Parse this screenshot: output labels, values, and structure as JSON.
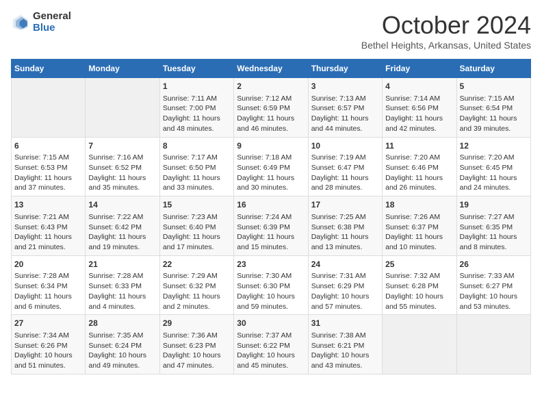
{
  "logo": {
    "general": "General",
    "blue": "Blue"
  },
  "title": "October 2024",
  "location": "Bethel Heights, Arkansas, United States",
  "days_of_week": [
    "Sunday",
    "Monday",
    "Tuesday",
    "Wednesday",
    "Thursday",
    "Friday",
    "Saturday"
  ],
  "weeks": [
    [
      {
        "day": null,
        "sunrise": null,
        "sunset": null,
        "daylight": null
      },
      {
        "day": null,
        "sunrise": null,
        "sunset": null,
        "daylight": null
      },
      {
        "day": "1",
        "sunrise": "Sunrise: 7:11 AM",
        "sunset": "Sunset: 7:00 PM",
        "daylight": "Daylight: 11 hours and 48 minutes."
      },
      {
        "day": "2",
        "sunrise": "Sunrise: 7:12 AM",
        "sunset": "Sunset: 6:59 PM",
        "daylight": "Daylight: 11 hours and 46 minutes."
      },
      {
        "day": "3",
        "sunrise": "Sunrise: 7:13 AM",
        "sunset": "Sunset: 6:57 PM",
        "daylight": "Daylight: 11 hours and 44 minutes."
      },
      {
        "day": "4",
        "sunrise": "Sunrise: 7:14 AM",
        "sunset": "Sunset: 6:56 PM",
        "daylight": "Daylight: 11 hours and 42 minutes."
      },
      {
        "day": "5",
        "sunrise": "Sunrise: 7:15 AM",
        "sunset": "Sunset: 6:54 PM",
        "daylight": "Daylight: 11 hours and 39 minutes."
      }
    ],
    [
      {
        "day": "6",
        "sunrise": "Sunrise: 7:15 AM",
        "sunset": "Sunset: 6:53 PM",
        "daylight": "Daylight: 11 hours and 37 minutes."
      },
      {
        "day": "7",
        "sunrise": "Sunrise: 7:16 AM",
        "sunset": "Sunset: 6:52 PM",
        "daylight": "Daylight: 11 hours and 35 minutes."
      },
      {
        "day": "8",
        "sunrise": "Sunrise: 7:17 AM",
        "sunset": "Sunset: 6:50 PM",
        "daylight": "Daylight: 11 hours and 33 minutes."
      },
      {
        "day": "9",
        "sunrise": "Sunrise: 7:18 AM",
        "sunset": "Sunset: 6:49 PM",
        "daylight": "Daylight: 11 hours and 30 minutes."
      },
      {
        "day": "10",
        "sunrise": "Sunrise: 7:19 AM",
        "sunset": "Sunset: 6:47 PM",
        "daylight": "Daylight: 11 hours and 28 minutes."
      },
      {
        "day": "11",
        "sunrise": "Sunrise: 7:20 AM",
        "sunset": "Sunset: 6:46 PM",
        "daylight": "Daylight: 11 hours and 26 minutes."
      },
      {
        "day": "12",
        "sunrise": "Sunrise: 7:20 AM",
        "sunset": "Sunset: 6:45 PM",
        "daylight": "Daylight: 11 hours and 24 minutes."
      }
    ],
    [
      {
        "day": "13",
        "sunrise": "Sunrise: 7:21 AM",
        "sunset": "Sunset: 6:43 PM",
        "daylight": "Daylight: 11 hours and 21 minutes."
      },
      {
        "day": "14",
        "sunrise": "Sunrise: 7:22 AM",
        "sunset": "Sunset: 6:42 PM",
        "daylight": "Daylight: 11 hours and 19 minutes."
      },
      {
        "day": "15",
        "sunrise": "Sunrise: 7:23 AM",
        "sunset": "Sunset: 6:40 PM",
        "daylight": "Daylight: 11 hours and 17 minutes."
      },
      {
        "day": "16",
        "sunrise": "Sunrise: 7:24 AM",
        "sunset": "Sunset: 6:39 PM",
        "daylight": "Daylight: 11 hours and 15 minutes."
      },
      {
        "day": "17",
        "sunrise": "Sunrise: 7:25 AM",
        "sunset": "Sunset: 6:38 PM",
        "daylight": "Daylight: 11 hours and 13 minutes."
      },
      {
        "day": "18",
        "sunrise": "Sunrise: 7:26 AM",
        "sunset": "Sunset: 6:37 PM",
        "daylight": "Daylight: 11 hours and 10 minutes."
      },
      {
        "day": "19",
        "sunrise": "Sunrise: 7:27 AM",
        "sunset": "Sunset: 6:35 PM",
        "daylight": "Daylight: 11 hours and 8 minutes."
      }
    ],
    [
      {
        "day": "20",
        "sunrise": "Sunrise: 7:28 AM",
        "sunset": "Sunset: 6:34 PM",
        "daylight": "Daylight: 11 hours and 6 minutes."
      },
      {
        "day": "21",
        "sunrise": "Sunrise: 7:28 AM",
        "sunset": "Sunset: 6:33 PM",
        "daylight": "Daylight: 11 hours and 4 minutes."
      },
      {
        "day": "22",
        "sunrise": "Sunrise: 7:29 AM",
        "sunset": "Sunset: 6:32 PM",
        "daylight": "Daylight: 11 hours and 2 minutes."
      },
      {
        "day": "23",
        "sunrise": "Sunrise: 7:30 AM",
        "sunset": "Sunset: 6:30 PM",
        "daylight": "Daylight: 10 hours and 59 minutes."
      },
      {
        "day": "24",
        "sunrise": "Sunrise: 7:31 AM",
        "sunset": "Sunset: 6:29 PM",
        "daylight": "Daylight: 10 hours and 57 minutes."
      },
      {
        "day": "25",
        "sunrise": "Sunrise: 7:32 AM",
        "sunset": "Sunset: 6:28 PM",
        "daylight": "Daylight: 10 hours and 55 minutes."
      },
      {
        "day": "26",
        "sunrise": "Sunrise: 7:33 AM",
        "sunset": "Sunset: 6:27 PM",
        "daylight": "Daylight: 10 hours and 53 minutes."
      }
    ],
    [
      {
        "day": "27",
        "sunrise": "Sunrise: 7:34 AM",
        "sunset": "Sunset: 6:26 PM",
        "daylight": "Daylight: 10 hours and 51 minutes."
      },
      {
        "day": "28",
        "sunrise": "Sunrise: 7:35 AM",
        "sunset": "Sunset: 6:24 PM",
        "daylight": "Daylight: 10 hours and 49 minutes."
      },
      {
        "day": "29",
        "sunrise": "Sunrise: 7:36 AM",
        "sunset": "Sunset: 6:23 PM",
        "daylight": "Daylight: 10 hours and 47 minutes."
      },
      {
        "day": "30",
        "sunrise": "Sunrise: 7:37 AM",
        "sunset": "Sunset: 6:22 PM",
        "daylight": "Daylight: 10 hours and 45 minutes."
      },
      {
        "day": "31",
        "sunrise": "Sunrise: 7:38 AM",
        "sunset": "Sunset: 6:21 PM",
        "daylight": "Daylight: 10 hours and 43 minutes."
      },
      {
        "day": null,
        "sunrise": null,
        "sunset": null,
        "daylight": null
      },
      {
        "day": null,
        "sunrise": null,
        "sunset": null,
        "daylight": null
      }
    ]
  ]
}
